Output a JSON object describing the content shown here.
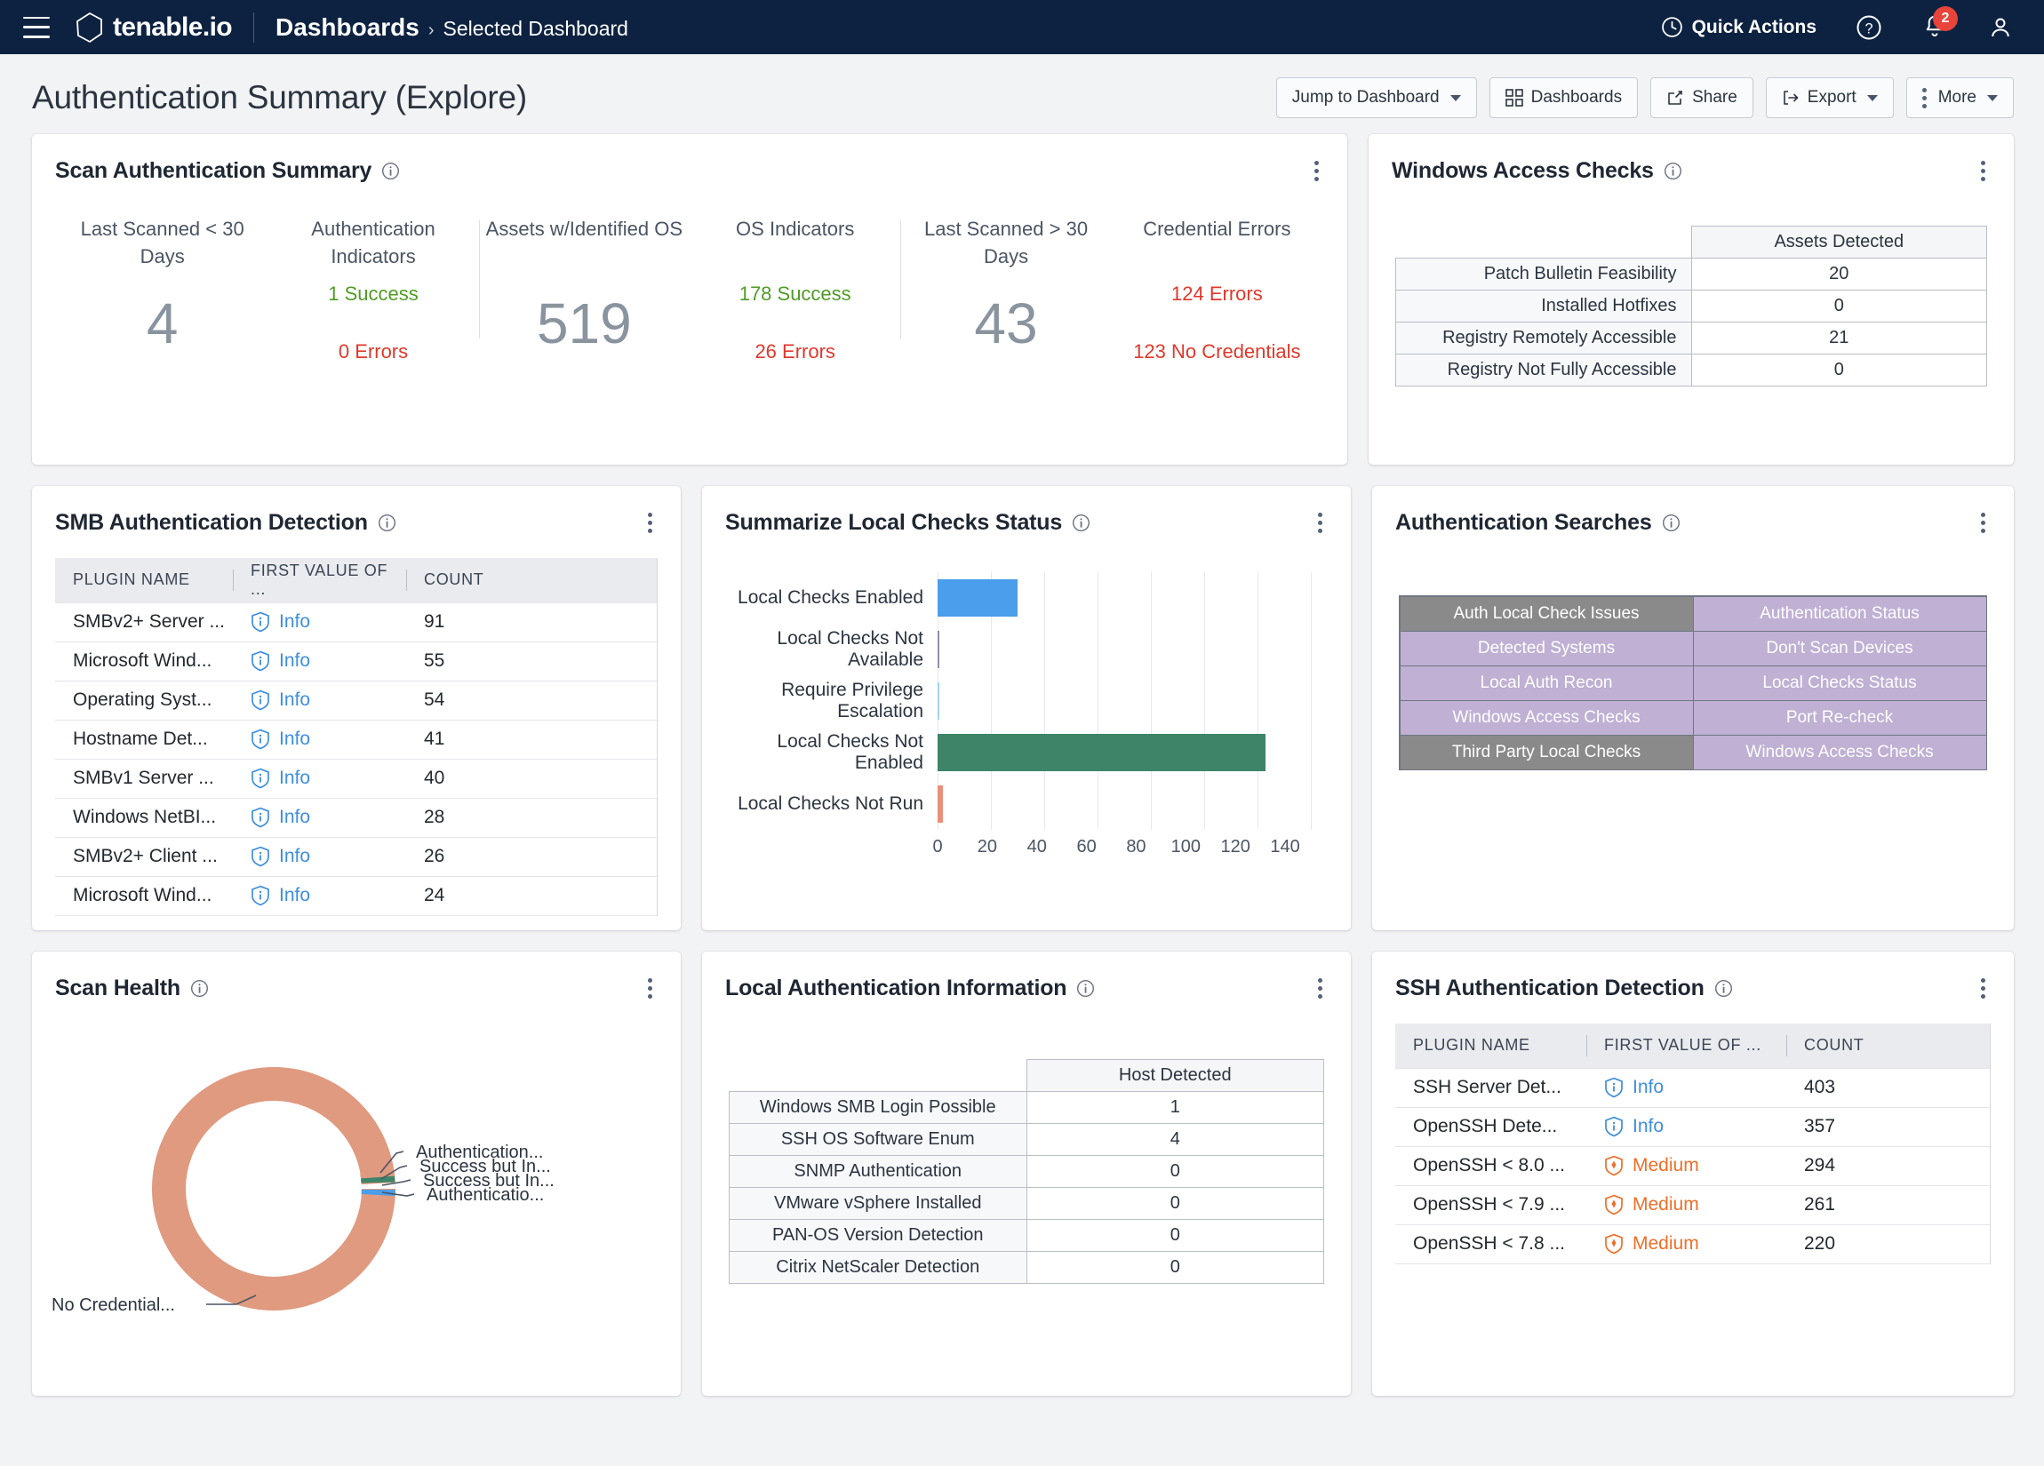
{
  "topnav": {
    "menu_icon": "hamburger-icon",
    "brand": "tenable.io",
    "breadcrumb_main": "Dashboards",
    "breadcrumb_sep": "›",
    "breadcrumb_sub": "Selected Dashboard",
    "quick_actions": "Quick Actions",
    "help_icon": "help-circle-icon",
    "notifications_icon": "bell-icon",
    "notifications_count": "2",
    "account_icon": "user-avatar-icon",
    "bar_color": "#0d2240",
    "badge_color": "#e8443a"
  },
  "page": {
    "title": "Authentication Summary (Explore)",
    "toolbar": [
      {
        "label": "Jump to Dashboard",
        "icon": "",
        "caret": true
      },
      {
        "label": "Dashboards",
        "icon": "grid-icon",
        "caret": false
      },
      {
        "label": "Share",
        "icon": "share-icon",
        "caret": false
      },
      {
        "label": "Export",
        "icon": "export-icon",
        "caret": true
      },
      {
        "label": "More",
        "icon": "kebab-icon",
        "caret": true
      }
    ]
  },
  "widgets": {
    "scan_auth_summary": {
      "title": "Scan Authentication Summary",
      "groups": [
        {
          "kpis": [
            {
              "label": "Last Scanned < 30 Days",
              "big": "4"
            },
            {
              "label": "Authentication Indicators",
              "ok": "1 Success",
              "err": "0 Errors"
            }
          ]
        },
        {
          "kpis": [
            {
              "label": "Assets w/Identified OS",
              "big": "519"
            },
            {
              "label": "OS Indicators",
              "ok": "178 Success",
              "err": "26 Errors"
            }
          ]
        },
        {
          "kpis": [
            {
              "label": "Last Scanned > 30 Days",
              "big": "43"
            },
            {
              "label": "Credential Errors",
              "err_top": "124 Errors",
              "err": "123 No Credentials"
            }
          ]
        }
      ],
      "success_color": "#4f9b26",
      "error_color": "#e0382c",
      "big_color": "#8a949f"
    },
    "windows_access_checks": {
      "title": "Windows Access Checks",
      "column_header": "Assets Detected",
      "rows": [
        {
          "label": "Patch Bulletin Feasibility",
          "value": "20"
        },
        {
          "label": "Installed Hotfixes",
          "value": "0"
        },
        {
          "label": "Registry Remotely Accessible",
          "value": "21"
        },
        {
          "label": "Registry Not Fully Accessible",
          "value": "0"
        }
      ]
    },
    "smb_auth_detection": {
      "title": "SMB Authentication Detection",
      "columns": [
        "PLUGIN NAME",
        "FIRST VALUE OF ...",
        "COUNT"
      ],
      "rows": [
        {
          "plugin": "SMBv2+ Server ...",
          "severity": "Info",
          "count": "91"
        },
        {
          "plugin": "Microsoft Wind...",
          "severity": "Info",
          "count": "55"
        },
        {
          "plugin": "Operating Syst...",
          "severity": "Info",
          "count": "54"
        },
        {
          "plugin": "Hostname Det...",
          "severity": "Info",
          "count": "41"
        },
        {
          "plugin": "SMBv1 Server ...",
          "severity": "Info",
          "count": "40"
        },
        {
          "plugin": "Windows NetBI...",
          "severity": "Info",
          "count": "28"
        },
        {
          "plugin": "SMBv2+ Client ...",
          "severity": "Info",
          "count": "26"
        },
        {
          "plugin": "Microsoft Wind...",
          "severity": "Info",
          "count": "24"
        }
      ]
    },
    "summarize_local_checks": {
      "title": "Summarize Local Checks Status"
    },
    "authentication_searches": {
      "title": "Authentication Searches",
      "tiles": [
        {
          "label": "Auth Local Check Issues",
          "style": "gray"
        },
        {
          "label": "Authentication Status",
          "style": "purple"
        },
        {
          "label": "Detected Systems",
          "style": "purple"
        },
        {
          "label": "Don't Scan Devices",
          "style": "purple"
        },
        {
          "label": "Local Auth Recon",
          "style": "purple"
        },
        {
          "label": "Local Checks Status",
          "style": "purple"
        },
        {
          "label": "Windows Access Checks",
          "style": "purple"
        },
        {
          "label": "Port Re-check",
          "style": "purple"
        },
        {
          "label": "Third Party Local Checks",
          "style": "gray"
        },
        {
          "label": "Windows Access Checks",
          "style": "purple"
        }
      ],
      "purple_color": "#bfb0d4",
      "gray_color": "#8a8a8a"
    },
    "scan_health": {
      "title": "Scan Health"
    },
    "local_auth_information": {
      "title": "Local Authentication Information",
      "column_header": "Host Detected",
      "rows": [
        {
          "label": "Windows SMB Login Possible",
          "value": "1"
        },
        {
          "label": "SSH OS Software Enum",
          "value": "4"
        },
        {
          "label": "SNMP Authentication",
          "value": "0"
        },
        {
          "label": "VMware vSphere Installed",
          "value": "0"
        },
        {
          "label": "PAN-OS Version Detection",
          "value": "0"
        },
        {
          "label": "Citrix NetScaler Detection",
          "value": "0"
        }
      ]
    },
    "ssh_auth_detection": {
      "title": "SSH Authentication Detection",
      "columns": [
        "PLUGIN NAME",
        "FIRST VALUE OF ...",
        "COUNT"
      ],
      "rows": [
        {
          "plugin": "SSH Server Det...",
          "severity": "Info",
          "count": "403"
        },
        {
          "plugin": "OpenSSH Dete...",
          "severity": "Info",
          "count": "357"
        },
        {
          "plugin": "OpenSSH < 8.0 ...",
          "severity": "Medium",
          "count": "294"
        },
        {
          "plugin": "OpenSSH < 7.9 ...",
          "severity": "Medium",
          "count": "261"
        },
        {
          "plugin": "OpenSSH < 7.8 ...",
          "severity": "Medium",
          "count": "220"
        }
      ]
    }
  },
  "chart_data": [
    {
      "type": "bar",
      "orientation": "horizontal",
      "title": "Summarize Local Checks Status",
      "categories": [
        "Local Checks Enabled",
        "Local Checks Not Available",
        "Require Privilege Escalation",
        "Local Checks Not Enabled",
        "Local Checks Not Run"
      ],
      "values": [
        30,
        0.4,
        0.4,
        123,
        2
      ],
      "colors": [
        "#4a9eeb",
        "#8b8fa8",
        "#9fd4e8",
        "#3d8468",
        "#e8907c"
      ],
      "xlabel": "",
      "ylabel": "",
      "xlim": [
        0,
        145
      ],
      "xticks": [
        0,
        20,
        40,
        60,
        80,
        100,
        120,
        140
      ],
      "grid": true,
      "legend": "none"
    },
    {
      "type": "pie",
      "subtype": "donut",
      "title": "Scan Health",
      "labels": [
        "No Credential...",
        "Authentication...",
        "Success but In...",
        "Success but In...",
        "Authenticatio..."
      ],
      "values": [
        97.2,
        0.7,
        0.5,
        0.8,
        0.8
      ],
      "colors": [
        "#e09a80",
        "#3d8468",
        "#ffffff",
        "#4a9eeb",
        "#e09a80"
      ],
      "legend": "labels-with-leader-lines"
    }
  ]
}
